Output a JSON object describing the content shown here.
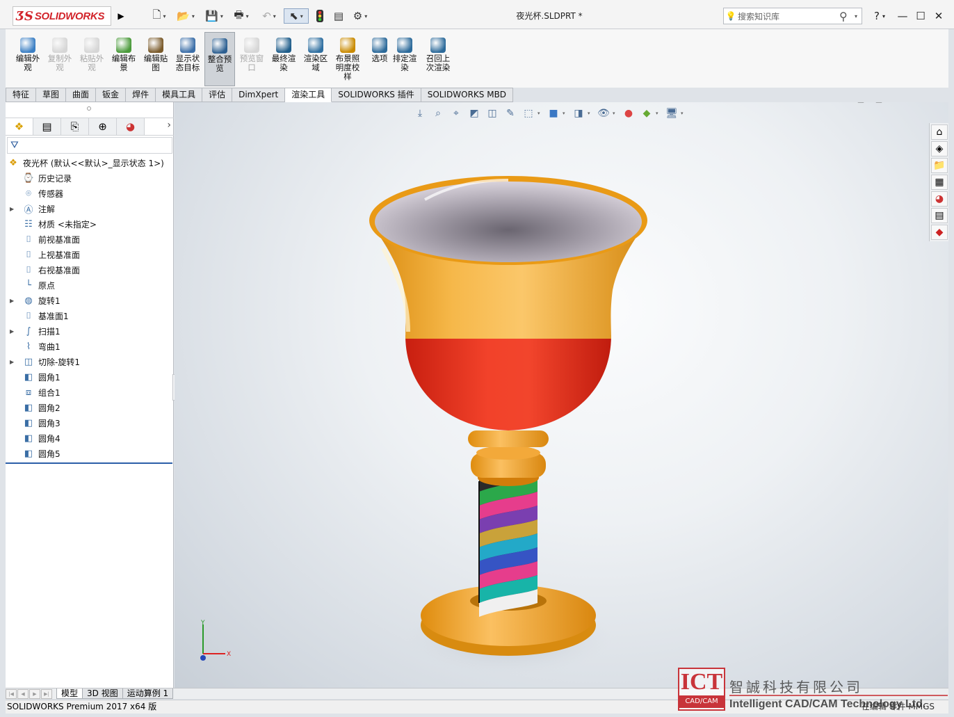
{
  "app": {
    "logo_brand": "SOLIDWORKS",
    "doc_title": "夜光杯.SLDPRT *",
    "search_placeholder": "搜索知识库",
    "help_label": "?"
  },
  "ribbon": [
    {
      "id": "edit-appearance",
      "label": "编辑外观",
      "enabled": true,
      "icon": "appearance-ball-icon",
      "color": "#3b7fc4"
    },
    {
      "id": "copy-appearance",
      "label": "复制外观",
      "enabled": false,
      "icon": "copy-appearance-icon",
      "color": "#999999"
    },
    {
      "id": "paste-appearance",
      "label": "粘贴外观",
      "enabled": false,
      "icon": "paste-appearance-icon",
      "color": "#999999"
    },
    {
      "id": "edit-scene",
      "label": "编辑布景",
      "enabled": true,
      "icon": "scene-icon",
      "color": "#4a9a3a"
    },
    {
      "id": "edit-decal",
      "label": "编辑贴图",
      "enabled": true,
      "icon": "decal-icon",
      "color": "#7a5a2a"
    },
    {
      "id": "display-state-target",
      "label": "显示状态目标",
      "enabled": true,
      "icon": "target-icon",
      "color": "#3b6ea8"
    },
    {
      "id": "integrated-preview",
      "label": "整合预览",
      "enabled": true,
      "active": true,
      "icon": "integrated-preview-icon",
      "color": "#2c5f91"
    },
    {
      "id": "preview-window",
      "label": "预览窗口",
      "enabled": false,
      "icon": "preview-window-icon",
      "color": "#999999"
    },
    {
      "id": "final-render",
      "label": "最终渲染",
      "enabled": true,
      "icon": "final-render-icon",
      "color": "#1f5d8a"
    },
    {
      "id": "render-region",
      "label": "渲染区域",
      "enabled": true,
      "icon": "render-region-icon",
      "color": "#2f6fa0"
    },
    {
      "id": "lighting-calibration",
      "label": "布景照明度校样",
      "enabled": true,
      "icon": "lighting-icon",
      "color": "#c98a00"
    },
    {
      "id": "options",
      "label": "选项",
      "enabled": true,
      "icon": "options-icon",
      "color": "#2c6a9a"
    },
    {
      "id": "schedule-render",
      "label": "排定渲染",
      "enabled": true,
      "icon": "schedule-icon",
      "color": "#2c6a9a"
    },
    {
      "id": "recall-last-render",
      "label": "召回上次渲染",
      "enabled": true,
      "icon": "recall-render-icon",
      "color": "#2c6a9a"
    }
  ],
  "tabs": [
    {
      "label": "特征",
      "active": false
    },
    {
      "label": "草图",
      "active": false
    },
    {
      "label": "曲面",
      "active": false
    },
    {
      "label": "钣金",
      "active": false
    },
    {
      "label": "焊件",
      "active": false
    },
    {
      "label": "模具工具",
      "active": false
    },
    {
      "label": "评估",
      "active": false
    },
    {
      "label": "DimXpert",
      "active": false
    },
    {
      "label": "渲染工具",
      "active": true
    },
    {
      "label": "SOLIDWORKS 插件",
      "active": false
    },
    {
      "label": "SOLIDWORKS MBD",
      "active": false
    }
  ],
  "tree": {
    "root": "夜光杯  (默认<<默认>_显示状态 1>)",
    "items": [
      {
        "label": "历史记录",
        "icon": "history-icon",
        "expandable": false
      },
      {
        "label": "传感器",
        "icon": "sensor-icon",
        "expandable": false
      },
      {
        "label": "注解",
        "icon": "annotation-icon",
        "expandable": true
      },
      {
        "label": "材质 <未指定>",
        "icon": "material-icon",
        "expandable": false
      },
      {
        "label": "前视基准面",
        "icon": "plane-icon",
        "expandable": false
      },
      {
        "label": "上视基准面",
        "icon": "plane-icon",
        "expandable": false
      },
      {
        "label": "右视基准面",
        "icon": "plane-icon",
        "expandable": false
      },
      {
        "label": "原点",
        "icon": "origin-icon",
        "expandable": false
      },
      {
        "label": "旋转1",
        "icon": "revolve-icon",
        "expandable": true
      },
      {
        "label": "基准面1",
        "icon": "plane-icon",
        "expandable": false
      },
      {
        "label": "扫描1",
        "icon": "sweep-icon",
        "expandable": true
      },
      {
        "label": "弯曲1",
        "icon": "flex-icon",
        "expandable": false
      },
      {
        "label": "切除-旋转1",
        "icon": "cut-revolve-icon",
        "expandable": true
      },
      {
        "label": "圆角1",
        "icon": "fillet-icon",
        "expandable": false
      },
      {
        "label": "组合1",
        "icon": "combine-icon",
        "expandable": false
      },
      {
        "label": "圆角2",
        "icon": "fillet-icon",
        "expandable": false
      },
      {
        "label": "圆角3",
        "icon": "fillet-icon",
        "expandable": false
      },
      {
        "label": "圆角4",
        "icon": "fillet-icon",
        "expandable": false
      },
      {
        "label": "圆角5",
        "icon": "fillet-icon",
        "expandable": false
      }
    ]
  },
  "bottom_tabs": [
    {
      "label": "模型",
      "active": true
    },
    {
      "label": "3D 视图",
      "active": false
    },
    {
      "label": "运动算例 1",
      "active": false
    }
  ],
  "status": {
    "left": "SOLIDWORKS Premium 2017 x64 版",
    "right": "在编辑 零件        MMGS"
  },
  "watermark": {
    "ict": "ICT",
    "cadcam": "CAD/CAM",
    "cn": "智誠科技有限公司",
    "en": "Intelligent CAD/CAM Technology Ltd."
  },
  "colors": {
    "accent": "#2b5ea8",
    "brand_red": "#d2232a",
    "cup_orange": "#f0a11f",
    "cup_red": "#e8321c"
  }
}
